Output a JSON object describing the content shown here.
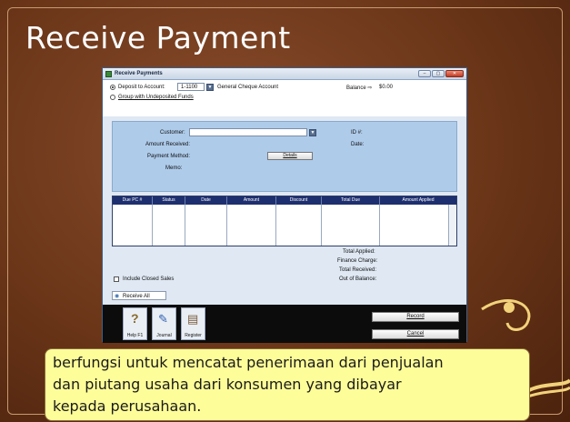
{
  "slide": {
    "title": "Receive Payment",
    "caption_lines": [
      "berfungsi untuk mencatat penerimaan dari penjualan",
      "dan piutang usaha dari konsumen yang dibayar",
      "kepada perusahaan."
    ],
    "accent_color": "#fdfd99",
    "background_color": "#6a3518"
  },
  "window": {
    "title": "Receive Payments",
    "buttons": {
      "minimize": "–",
      "maximize": "▢",
      "close": "✕"
    }
  },
  "deposit": {
    "deposit_label": "Deposit to Account:",
    "account_number": "1-1100",
    "account_name": "General Cheque Account",
    "balance_label": "Balance ⇨",
    "balance_value": "$0.00",
    "group_label": "Group with Undeposited Funds"
  },
  "form": {
    "customer_label": "Customer:",
    "amount_label": "Amount Received:",
    "method_label": "Payment Method:",
    "memo_label": "Memo:",
    "id_label": "ID #:",
    "date_label": "Date:",
    "details_button": "Details"
  },
  "grid": {
    "columns": [
      "Due PC #",
      "Status",
      "Date",
      "Amount",
      "Discount",
      "Total Due",
      "Amount Applied"
    ]
  },
  "totals": {
    "labels": [
      "Total Applied:",
      "Finance Charge:",
      "Total Received:",
      "Out of Balance:"
    ],
    "include_closed_label": "Include Closed Sales",
    "receive_all_label": "Receive All"
  },
  "toolbar": {
    "help_label": "Help F1",
    "journal_label": "Journal",
    "register_label": "Register",
    "record_label": "Record",
    "cancel_label": "Cancel"
  }
}
